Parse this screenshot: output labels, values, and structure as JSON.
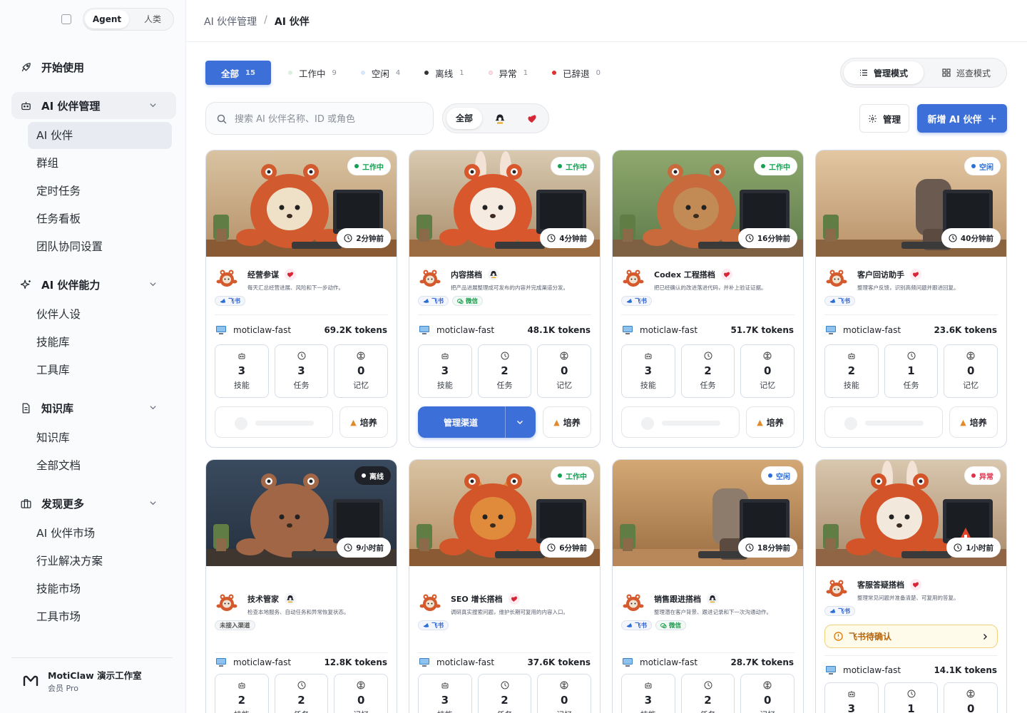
{
  "sidebar": {
    "mode_switch": {
      "agent": "Agent",
      "human": "人类"
    },
    "nav": {
      "getting_started": "开始使用",
      "partner_mgmt": "AI 伙伴管理",
      "partner_mgmt_items": [
        "AI 伙伴",
        "群组",
        "定时任务",
        "任务看板",
        "团队协同设置"
      ],
      "partner_ability": "AI 伙伴能力",
      "partner_ability_items": [
        "伙伴人设",
        "技能库",
        "工具库"
      ],
      "knowledge": "知识库",
      "knowledge_items": [
        "知识库",
        "全部文档"
      ],
      "discover": "发现更多",
      "discover_items": [
        "AI 伙伴市场",
        "行业解决方案",
        "技能市场",
        "工具市场"
      ]
    },
    "workspace": {
      "name": "MotiClaw 演示工作室",
      "plan": "会员 Pro"
    }
  },
  "breadcrumb": {
    "parent": "AI 伙伴管理",
    "separator": "/",
    "current": "AI 伙伴"
  },
  "filters": [
    {
      "label": "全部",
      "count": "15",
      "color": ""
    },
    {
      "label": "工作中",
      "count": "9",
      "color": "#d9f0e0"
    },
    {
      "label": "空闲",
      "count": "4",
      "color": "#d6e6fb"
    },
    {
      "label": "离线",
      "count": "1",
      "color": "#333333"
    },
    {
      "label": "异常",
      "count": "1",
      "color": "#fbe0e4"
    },
    {
      "label": "已辞退",
      "count": "0",
      "color": "#e03131"
    }
  ],
  "view_mode": {
    "manage": "管理模式",
    "inspect": "巡查模式"
  },
  "search": {
    "placeholder": "搜索 AI 伙伴名称、ID 或角色"
  },
  "channel_filter": {
    "all": "全部"
  },
  "toolbar": {
    "manage": "管理",
    "new_partner": "新增 AI 伙伴"
  },
  "colors": {
    "accent": "#3d6fd8",
    "working": "#12a150",
    "idle": "#2b6fd8",
    "offline": "#222222",
    "error": "#e0314b"
  },
  "labels": {
    "skills": "技能",
    "tasks": "任务",
    "memory": "记忆",
    "cultivate": "培养",
    "manage_channel": "管理渠道",
    "feishu": "飞书",
    "wechat": "微信",
    "no_channel": "未接入渠道",
    "feishu_pending": "飞书待确认"
  },
  "cards": [
    {
      "name": "经营参谋",
      "desc": "每天汇总经营进展、风险和下一步动作。",
      "status": "工作中",
      "time": "2分钟前",
      "model": "moticlaw-fast",
      "tokens": "69.2K tokens",
      "skills": "3",
      "tasks": "3",
      "memory": "0"
    },
    {
      "name": "内容搭档",
      "desc": "把产品进展整理成可发布的内容并完成渠道分发。",
      "status": "工作中",
      "time": "4分钟前",
      "model": "moticlaw-fast",
      "tokens": "48.1K tokens",
      "skills": "3",
      "tasks": "2",
      "memory": "0"
    },
    {
      "name": "Codex 工程搭档",
      "desc": "把已经确认的改进落进代码，并补上验证证据。",
      "status": "工作中",
      "time": "16分钟前",
      "model": "moticlaw-fast",
      "tokens": "51.7K tokens",
      "skills": "3",
      "tasks": "2",
      "memory": "0"
    },
    {
      "name": "客户回访助手",
      "desc": "整理客户反馈，识别高频问题并跟进回复。",
      "status": "空闲",
      "time": "40分钟前",
      "model": "moticlaw-fast",
      "tokens": "23.6K tokens",
      "skills": "2",
      "tasks": "1",
      "memory": "0"
    },
    {
      "name": "技术管家",
      "desc": "检查本地服务、自动任务和异常恢复状态。",
      "status": "离线",
      "time": "9小时前",
      "model": "moticlaw-fast",
      "tokens": "12.8K tokens",
      "skills": "2",
      "tasks": "2",
      "memory": "0"
    },
    {
      "name": "SEO 增长搭档",
      "desc": "调研真实搜索问题，维护长期可复用的内容入口。",
      "status": "工作中",
      "time": "6分钟前",
      "model": "moticlaw-fast",
      "tokens": "37.6K tokens",
      "skills": "3",
      "tasks": "2",
      "memory": "0"
    },
    {
      "name": "销售跟进搭档",
      "desc": "整理潜在客户背景、跟进记录和下一次沟通动作。",
      "status": "空闲",
      "time": "18分钟前",
      "model": "moticlaw-fast",
      "tokens": "28.7K tokens",
      "skills": "3",
      "tasks": "2",
      "memory": "0"
    },
    {
      "name": "客服答疑搭档",
      "desc": "整理常见问题并准备清楚、可复用的答复。",
      "status": "异常",
      "time": "1小时前",
      "model": "moticlaw-fast",
      "tokens": "14.1K tokens",
      "skills": "3",
      "tasks": "1",
      "memory": "0"
    }
  ]
}
